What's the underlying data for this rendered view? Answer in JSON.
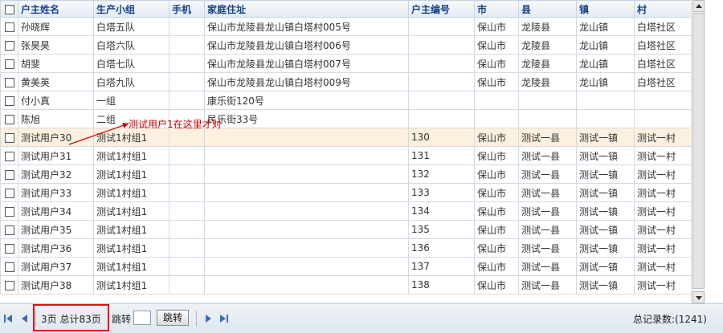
{
  "columns": [
    "户主姓名",
    "生产小组",
    "手机",
    "家庭住址",
    "户主编号",
    "市",
    "县",
    "镇",
    "村"
  ],
  "rows": [
    [
      "孙晓辉",
      "白塔五队",
      "",
      "保山市龙陵县龙山镇白塔村005号",
      "",
      "保山市",
      "龙陵县",
      "龙山镇",
      "白塔社区"
    ],
    [
      "张昊昊",
      "白塔六队",
      "",
      "保山市龙陵县龙山镇白塔村006号",
      "",
      "保山市",
      "龙陵县",
      "龙山镇",
      "白塔社区"
    ],
    [
      "胡斐",
      "白塔七队",
      "",
      "保山市龙陵县龙山镇白塔村007号",
      "",
      "保山市",
      "龙陵县",
      "龙山镇",
      "白塔社区"
    ],
    [
      "黄美英",
      "白塔九队",
      "",
      "保山市龙陵县龙山镇白塔村009号",
      "",
      "保山市",
      "龙陵县",
      "龙山镇",
      "白塔社区"
    ],
    [
      "付小真",
      "一组",
      "",
      "康乐街120号",
      "",
      "",
      "",
      "",
      ""
    ],
    [
      "陈旭",
      "二组",
      "",
      "民乐街33号",
      "",
      "",
      "",
      "",
      ""
    ],
    [
      "测试用户30",
      "测试1村组1",
      "",
      "",
      "130",
      "保山市",
      "测试一县",
      "测试一镇",
      "测试一村"
    ],
    [
      "测试用户31",
      "测试1村组1",
      "",
      "",
      "131",
      "保山市",
      "测试一县",
      "测试一镇",
      "测试一村"
    ],
    [
      "测试用户32",
      "测试1村组1",
      "",
      "",
      "132",
      "保山市",
      "测试一县",
      "测试一镇",
      "测试一村"
    ],
    [
      "测试用户33",
      "测试1村组1",
      "",
      "",
      "133",
      "保山市",
      "测试一县",
      "测试一镇",
      "测试一村"
    ],
    [
      "测试用户34",
      "测试1村组1",
      "",
      "",
      "134",
      "保山市",
      "测试一县",
      "测试一镇",
      "测试一村"
    ],
    [
      "测试用户35",
      "测试1村组1",
      "",
      "",
      "135",
      "保山市",
      "测试一县",
      "测试一镇",
      "测试一村"
    ],
    [
      "测试用户36",
      "测试1村组1",
      "",
      "",
      "136",
      "保山市",
      "测试一县",
      "测试一镇",
      "测试一村"
    ],
    [
      "测试用户37",
      "测试1村组1",
      "",
      "",
      "137",
      "保山市",
      "测试一县",
      "测试一镇",
      "测试一村"
    ],
    [
      "测试用户38",
      "测试1村组1",
      "",
      "",
      "138",
      "保山市",
      "测试一县",
      "测试一镇",
      "测试一村"
    ]
  ],
  "highlight_row": 6,
  "annotation": "测试用户1在这里才对",
  "annotation_color": "#cc0000",
  "pager": {
    "page_info": "3页 总计83页",
    "jump_label": "跳转",
    "jump_value": "",
    "jump_button": "跳转",
    "total": "总记录数:(1241)"
  },
  "icons": {
    "first": "first-page-icon",
    "prev": "prev-page-icon",
    "next": "next-page-icon",
    "last": "last-page-icon"
  }
}
